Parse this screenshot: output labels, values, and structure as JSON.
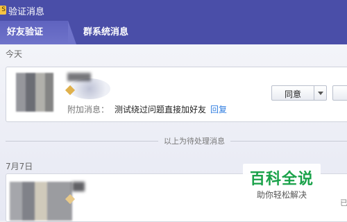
{
  "window": {
    "title": "验证消息",
    "icon": "app-icon",
    "icon_char": "S"
  },
  "tabs": [
    {
      "label": "好友验证",
      "active": true
    },
    {
      "label": "群系统消息",
      "active": false
    }
  ],
  "sections": {
    "today": "今天",
    "date2": "7月7日"
  },
  "request": {
    "extra_label": "附加消息：",
    "extra_text": "测试绕过问题直接加好友",
    "reply_link": "回复",
    "agree_button": "同意"
  },
  "divider_text": "以上为待处理消息",
  "second_request": {
    "trail_text": "已"
  },
  "watermark": {
    "main": "百科全说",
    "sub": "助你轻松解决"
  },
  "colors": {
    "titlebar": "#4a4ea8",
    "link": "#2f7de0",
    "watermark": "#1aa24a"
  }
}
